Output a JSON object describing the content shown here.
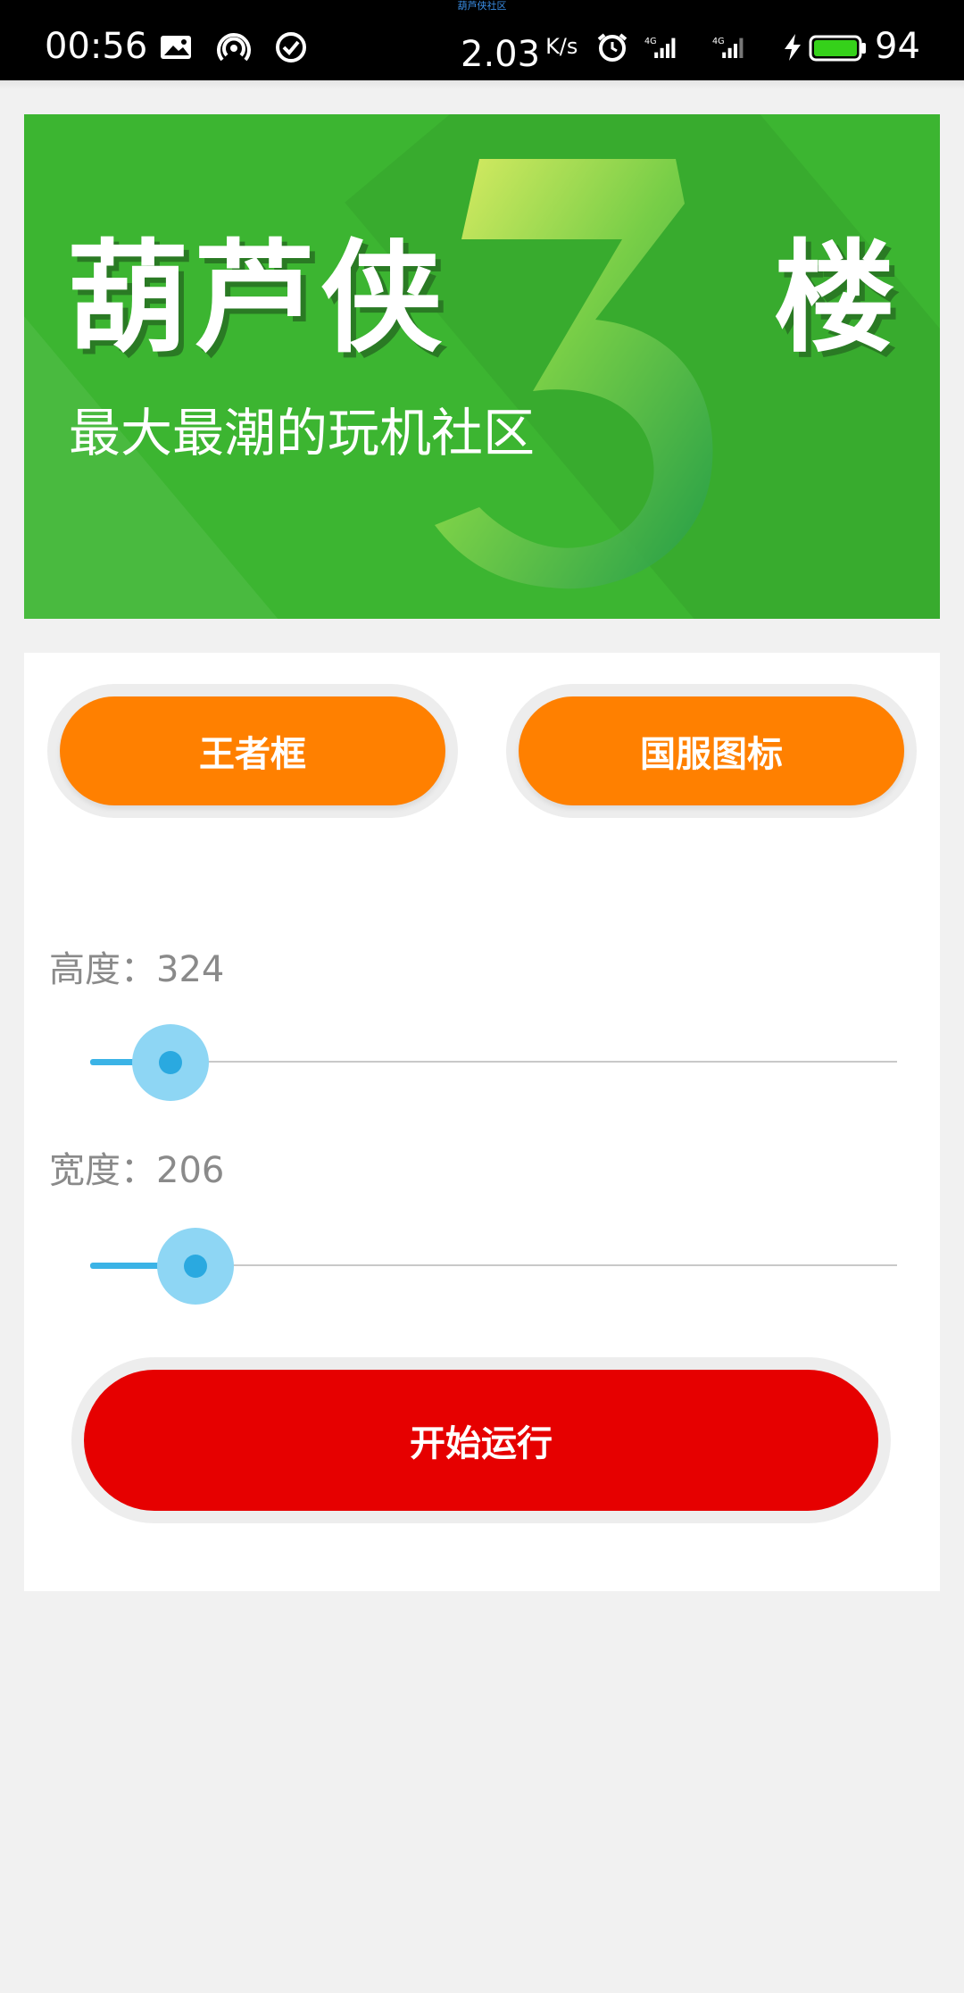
{
  "status_bar": {
    "top_text": "葫芦侠社区",
    "time": "00:56",
    "speed_value": "2.03",
    "speed_unit": "K/s",
    "battery": "94",
    "icons": [
      "image-icon",
      "hotspot-icon",
      "check-circle-icon",
      "alarm-icon",
      "signal-4g-icon",
      "signal-4g-icon-2",
      "charging-icon",
      "battery-icon"
    ]
  },
  "banner": {
    "title": "葫芦侠",
    "digit": "3",
    "suffix": "楼",
    "subtitle": "最大最潮的玩机社区"
  },
  "buttons": {
    "left_label": "王者框",
    "right_label": "国服图标",
    "run_label": "开始运行"
  },
  "height_control": {
    "label": "高度：324",
    "value_fraction": 0.1
  },
  "width_control": {
    "label": "宽度：206",
    "value_fraction": 0.13
  },
  "colors": {
    "orange": "#ff8000",
    "red": "#e60000",
    "slider_blue": "#3bb3e6",
    "banner_green": "#3cb531"
  }
}
